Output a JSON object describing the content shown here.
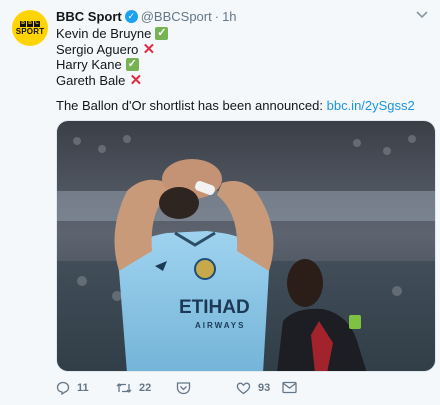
{
  "tweet": {
    "author_name": "BBC Sport",
    "handle": "@BBCSport",
    "separator": "·",
    "time": "1h",
    "avatar": {
      "box1": "B",
      "box2": "B",
      "box3": "C",
      "word": "SPORT"
    },
    "lines": [
      {
        "text": "Kevin de Bruyne",
        "mark": "✓",
        "status": "check"
      },
      {
        "text": "Sergio Aguero",
        "mark": "✕",
        "status": "cross"
      },
      {
        "text": "Harry Kane",
        "mark": "✓",
        "status": "check"
      },
      {
        "text": "Gareth Bale",
        "mark": "✕",
        "status": "cross"
      }
    ],
    "announce_text": "The Ballon d'Or shortlist has been announced: ",
    "link": "bbc.in/2ySgss2",
    "media": {
      "shirt_sponsor": "ETIHAD",
      "shirt_sub": "AIRWAYS"
    }
  },
  "actions": {
    "replies": "11",
    "retweets": "22",
    "likes": "93"
  },
  "colors": {
    "brand_yellow": "#ffd400",
    "link": "#1b95e0",
    "verified": "#1da1f2",
    "check_green": "#77b255",
    "cross_red": "#dd2e44",
    "shirt_blue": "#8fc9e8"
  }
}
